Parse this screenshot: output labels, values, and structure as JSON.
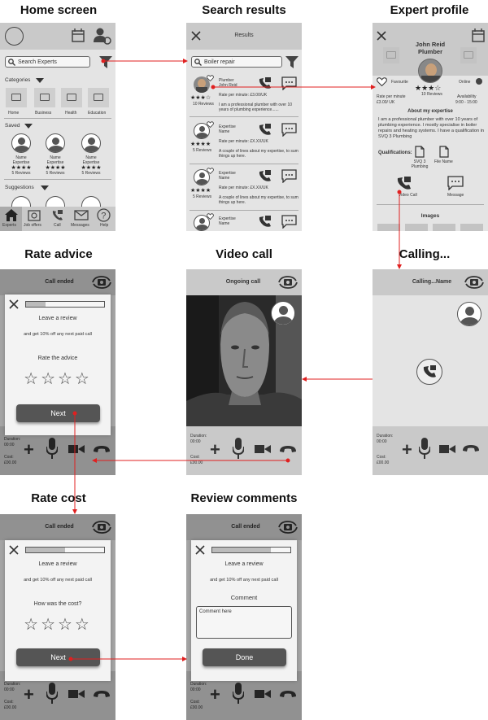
{
  "titles": {
    "home": "Home screen",
    "search": "Search results",
    "profile": "Expert profile",
    "rate_advice": "Rate advice",
    "video": "Video call",
    "calling": "Calling...",
    "rate_cost": "Rate cost",
    "review": "Review comments"
  },
  "home": {
    "search_placeholder": "Search Experts",
    "categories_label": "Categories",
    "categories": [
      "Home",
      "Business",
      "Health",
      "Education"
    ],
    "saved_label": "Saved",
    "saved": [
      {
        "name": "Name",
        "expertise": "Expertise",
        "stars": "★★★★",
        "reviews": "5 Reviews"
      },
      {
        "name": "Name",
        "expertise": "Expertise",
        "stars": "★★★★",
        "reviews": "5 Reviews"
      },
      {
        "name": "Name",
        "expertise": "Expertise",
        "stars": "★★★★",
        "reviews": "5 Reviews"
      }
    ],
    "suggestions_label": "Suggestions",
    "nav": [
      "Experts",
      "Job offers",
      "Call",
      "Messages",
      "Help"
    ]
  },
  "search": {
    "header": "Results",
    "query": "Boiler repair",
    "results": [
      {
        "line1": "Plumber",
        "line2": "John Reid",
        "rate": "Rate per minute: £3.00/UK",
        "desc": "I am a professional plumber with over 10 years of plumbing experience......",
        "stars": "★★★☆",
        "reviews": "10 Reviews"
      },
      {
        "line1": "Expertise",
        "line2": "Name",
        "rate": "Rate per minute: £X.XX/UK",
        "desc": "A couple of lines about my expertise, to sum things up here.",
        "stars": "★★★★",
        "reviews": "5 Reviews"
      },
      {
        "line1": "Expertise",
        "line2": "Name",
        "rate": "Rate per minute: £X.XX/UK",
        "desc": "A couple of lines about my expertise, to sum things up here.",
        "stars": "★★★★",
        "reviews": "5 Reviews"
      },
      {
        "line1": "Expertise",
        "line2": "Name",
        "rate": "",
        "desc": "",
        "stars": "",
        "reviews": ""
      }
    ]
  },
  "profile": {
    "name": "John Reid",
    "job": "Plumber",
    "favourite": "Favourite",
    "stars": "★★★☆",
    "reviews": "10 Reviews",
    "online": "Online",
    "rate_label": "Rate per minute",
    "rate_value": "£3.00/ UK",
    "avail_label": "Availability",
    "avail_value": "9:00 - 15:00",
    "about_title": "About my expertise",
    "about_text": "I am a professional plumber with over 10 years of plumbing experience. I mostly specialise in boiler repairs and heating systems. I have a qualification in SVQ 3 Plumbing",
    "qual_label": "Qualifications:",
    "qual1": "SVQ 3 Plumbing",
    "qual2": "File Name",
    "video_call": "Video Call",
    "message": "Message",
    "images": "Images"
  },
  "calling": {
    "header": "Calling...Name",
    "duration_label": "Duration:",
    "duration": "00:00",
    "cost_label": "Cost:",
    "cost": "£00.00"
  },
  "video": {
    "header": "Ongoing call",
    "duration_label": "Duration:",
    "duration": "00:00",
    "cost_label": "Cost:",
    "cost": "£00.00"
  },
  "rate_advice": {
    "header": "Call ended",
    "leave": "Leave a review",
    "discount": "and get 10% off any next paid call",
    "question": "Rate the advice",
    "stars": "☆☆☆☆",
    "next": "Next",
    "duration_label": "Duration:",
    "duration": "00:00",
    "cost_label": "Cost:",
    "cost": "£00.00"
  },
  "rate_cost": {
    "header": "Call ended",
    "leave": "Leave a review",
    "discount": "and get 10% off any next paid call",
    "question": "How was the cost?",
    "stars": "☆☆☆☆",
    "next": "Next",
    "duration_label": "Duration:",
    "duration": "00:00",
    "cost_label": "Cost:",
    "cost": "£00.00"
  },
  "review": {
    "header": "Call ended",
    "leave": "Leave a review",
    "discount": "and get 10% off any next paid call",
    "comment_title": "Comment",
    "comment_placeholder": "Comment here",
    "done": "Done",
    "duration_label": "Duration:",
    "duration": "00:00",
    "cost_label": "Cost:",
    "cost": "£00.00"
  },
  "colors": {
    "connector": "#e02020",
    "panel": "#e4e4e4",
    "bar": "#c9c9c9",
    "button": "#555555"
  }
}
